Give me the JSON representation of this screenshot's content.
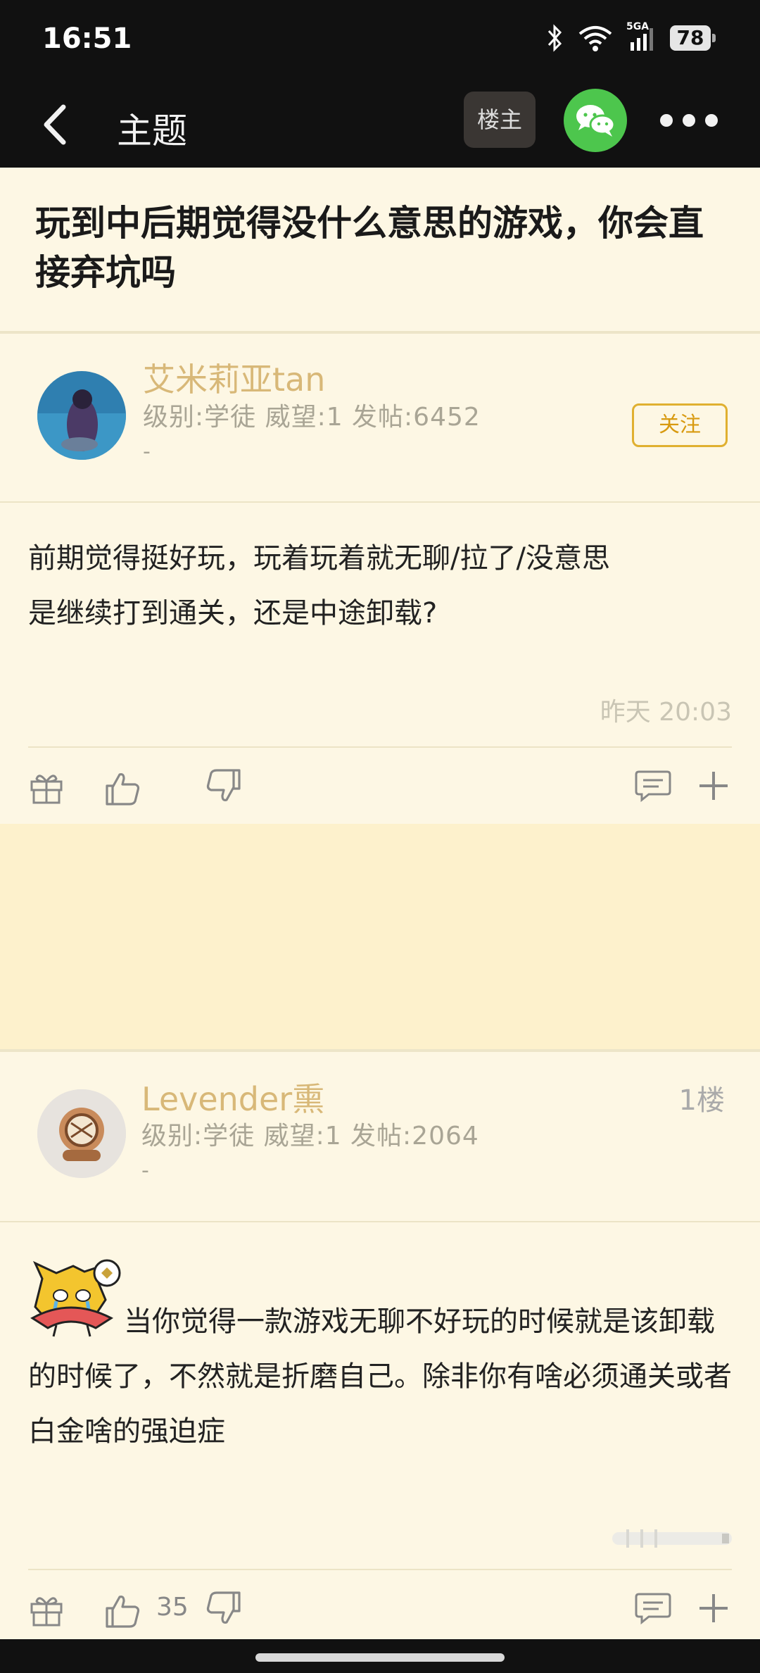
{
  "status_bar": {
    "time": "16:51",
    "network": "5GA",
    "battery": "78"
  },
  "nav": {
    "title": "主题",
    "owner_button": "楼主"
  },
  "topic": {
    "title": "玩到中后期觉得没什么意思的游戏，你会直接弃坑吗"
  },
  "op": {
    "username": "艾米莉亚tan",
    "meta": "级别:学徒 威望:1 发帖:6452",
    "signature": "-",
    "follow_label": "关注",
    "body_line1": "前期觉得挺好玩，玩着玩着就无聊/拉了/没意思",
    "body_line2": "是继续打到通关，还是中途卸载?",
    "time": "昨天 20:03"
  },
  "reply1": {
    "username": "Levender熏",
    "meta": "级别:学徒 威望:1 发帖:2064",
    "signature": "-",
    "floor": "1楼",
    "body": "当你觉得一款游戏无聊不好玩的时候就是该卸载的时候了，不然就是折磨自己。除非你有啥必须通关或者白金啥的强迫症",
    "likes": "35"
  },
  "colors": {
    "background": "#fdf7e4",
    "accent_gold": "#d8b878",
    "follow_orange": "#e0b030",
    "wechat_green": "#4dc64d",
    "topbar": "#111111"
  }
}
